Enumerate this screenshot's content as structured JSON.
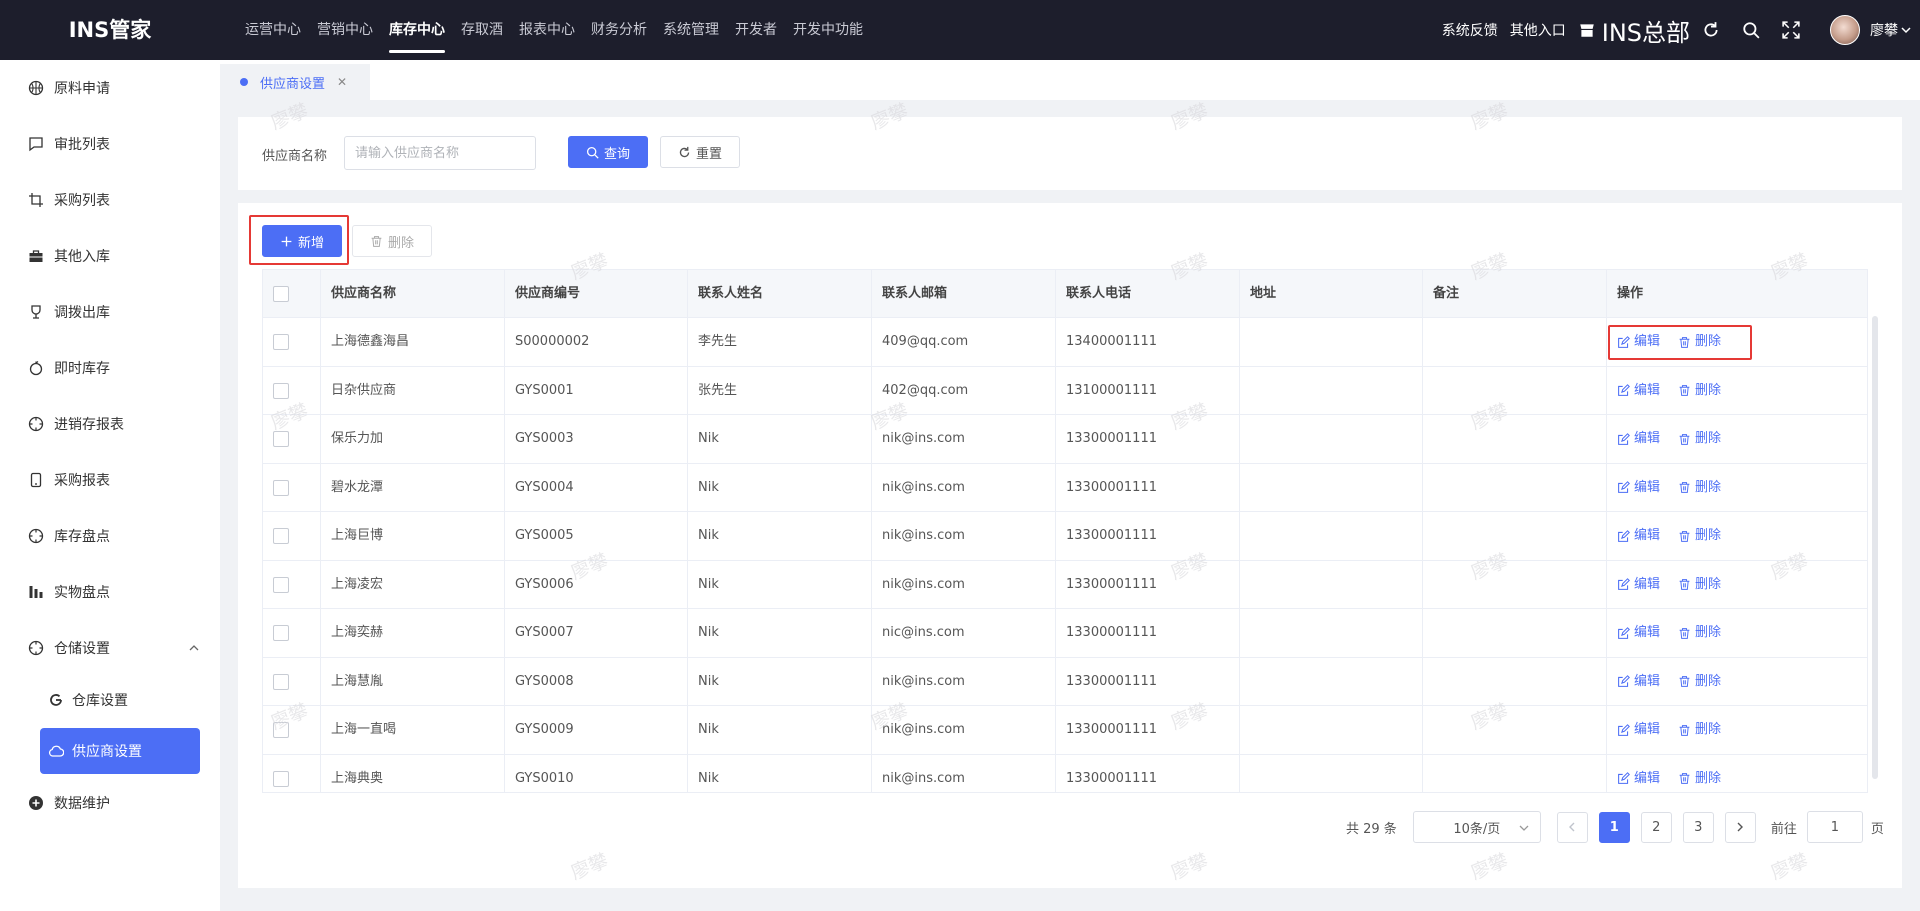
{
  "app": {
    "logo": "INS管家",
    "nav": [
      "运营中心",
      "营销中心",
      "库存中心",
      "存取酒",
      "报表中心",
      "财务分析",
      "系统管理",
      "开发者",
      "开发中功能"
    ],
    "nav_active_index": 2,
    "right_links": [
      "系统反馈",
      "其他入口"
    ],
    "org_name": "INS总部",
    "user_name": "廖攀"
  },
  "sidebar": {
    "items": [
      {
        "label": "原料申请",
        "icon": "basketball-icon"
      },
      {
        "label": "审批列表",
        "icon": "chat-icon"
      },
      {
        "label": "采购列表",
        "icon": "crop-icon"
      },
      {
        "label": "其他入库",
        "icon": "briefcase-icon"
      },
      {
        "label": "调拨出库",
        "icon": "trophy-icon"
      },
      {
        "label": "即时库存",
        "icon": "apple-icon"
      },
      {
        "label": "进销存报表",
        "icon": "compass-icon"
      },
      {
        "label": "采购报表",
        "icon": "phone-icon"
      },
      {
        "label": "库存盘点",
        "icon": "compass-icon"
      },
      {
        "label": "实物盘点",
        "icon": "bar-chart-icon"
      },
      {
        "label": "仓储设置",
        "icon": "compass-icon"
      }
    ],
    "sub_items": [
      {
        "label": "仓库设置",
        "icon": "refresh-icon"
      },
      {
        "label": "供应商设置",
        "icon": "cloud-icon"
      }
    ],
    "last_item": {
      "label": "数据维护",
      "icon": "plus-circle-icon"
    }
  },
  "tabs": [
    {
      "label": "供应商设置"
    }
  ],
  "search": {
    "label": "供应商名称",
    "placeholder": "请输入供应商名称",
    "query_label": "查询",
    "reset_label": "重置"
  },
  "toolbar": {
    "add_label": "新增",
    "delete_label": "删除"
  },
  "table": {
    "columns": [
      "供应商名称",
      "供应商编号",
      "联系人姓名",
      "联系人邮箱",
      "联系人电话",
      "地址",
      "备注",
      "操作"
    ],
    "rows": [
      [
        "上海德鑫海昌",
        "S00000002",
        "李先生",
        "409@qq.com",
        "13400001111",
        "",
        ""
      ],
      [
        "日杂供应商",
        "GYS0001",
        "张先生",
        "402@qq.com",
        "13100001111",
        "",
        ""
      ],
      [
        "保乐力加",
        "GYS0003",
        "Nik",
        "nik@ins.com",
        "13300001111",
        "",
        ""
      ],
      [
        "碧水龙潭",
        "GYS0004",
        "Nik",
        "nik@ins.com",
        "13300001111",
        "",
        ""
      ],
      [
        "上海巨博",
        "GYS0005",
        "Nik",
        "nik@ins.com",
        "13300001111",
        "",
        ""
      ],
      [
        "上海凌宏",
        "GYS0006",
        "Nik",
        "nik@ins.com",
        "13300001111",
        "",
        ""
      ],
      [
        "上海奕赫",
        "GYS0007",
        "Nik",
        "nic@ins.com",
        "13300001111",
        "",
        ""
      ],
      [
        "上海慧胤",
        "GYS0008",
        "Nik",
        "nik@ins.com",
        "13300001111",
        "",
        ""
      ],
      [
        "上海一直喝",
        "GYS0009",
        "Nik",
        "nik@ins.com",
        "13300001111",
        "",
        ""
      ],
      [
        "上海典奥",
        "GYS0010",
        "Nik",
        "nik@ins.com",
        "13300001111",
        "",
        ""
      ]
    ],
    "edit_label": "编辑",
    "delete_label": "删除"
  },
  "pagination": {
    "total_text": "共 29 条",
    "page_size": "10条/页",
    "pages": [
      "1",
      "2",
      "3"
    ],
    "current": "1",
    "goto_label": "前往",
    "goto_value": "1",
    "goto_suffix": "页"
  },
  "watermark": "廖攀",
  "colors": {
    "primary": "#4c6ef5",
    "header_bg": "#1d1e2c",
    "highlight": "#e53935"
  }
}
